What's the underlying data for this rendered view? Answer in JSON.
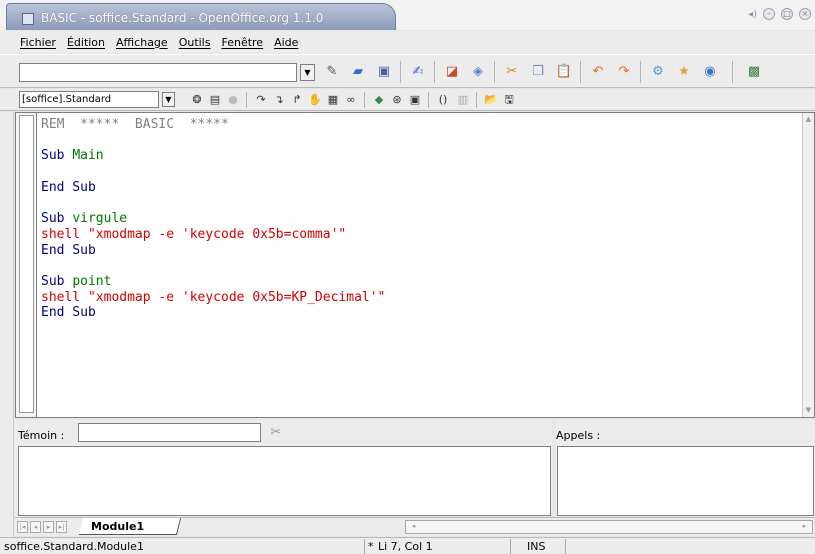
{
  "window": {
    "title": "BASIC - soffice.Standard - OpenOffice.org 1.1.0"
  },
  "menubar": {
    "items": [
      "Fichier",
      "Édition",
      "Affichage",
      "Outils",
      "Fenêtre",
      "Aide"
    ]
  },
  "toolbar": {
    "url_value": "",
    "library_value": "[soffice].Standard"
  },
  "editor": {
    "lines": [
      {
        "text": "REM  *****  BASIC  *****",
        "kind": "rem"
      },
      {
        "text": "",
        "kind": "plain"
      },
      {
        "text": "Sub Main",
        "kind": "sub"
      },
      {
        "text": "",
        "kind": "plain"
      },
      {
        "text": "End Sub",
        "kind": "endsub"
      },
      {
        "text": "",
        "kind": "plain"
      },
      {
        "text": "Sub virgule",
        "kind": "sub"
      },
      {
        "text": "shell \"xmodmap -e 'keycode 0x5b=comma'\"",
        "kind": "shell"
      },
      {
        "text": "End Sub",
        "kind": "endsub"
      },
      {
        "text": "",
        "kind": "plain"
      },
      {
        "text": "Sub point",
        "kind": "sub"
      },
      {
        "text": "shell \"xmodmap -e 'keycode 0x5b=KP_Decimal'\"",
        "kind": "shell"
      },
      {
        "text": "End Sub",
        "kind": "endsub"
      }
    ]
  },
  "watch": {
    "label": "Témoin :",
    "value": ""
  },
  "calls": {
    "label": "Appels :"
  },
  "tabs": {
    "module": "Module1"
  },
  "status": {
    "module_path": "soffice.Standard.Module1",
    "modified_marker": "*",
    "position": "Li 7, Col 1",
    "mode": "INS"
  },
  "colors": {
    "keyword": "#007700",
    "string": "#d50000",
    "comment": "#808080",
    "identifier": "#000080"
  }
}
